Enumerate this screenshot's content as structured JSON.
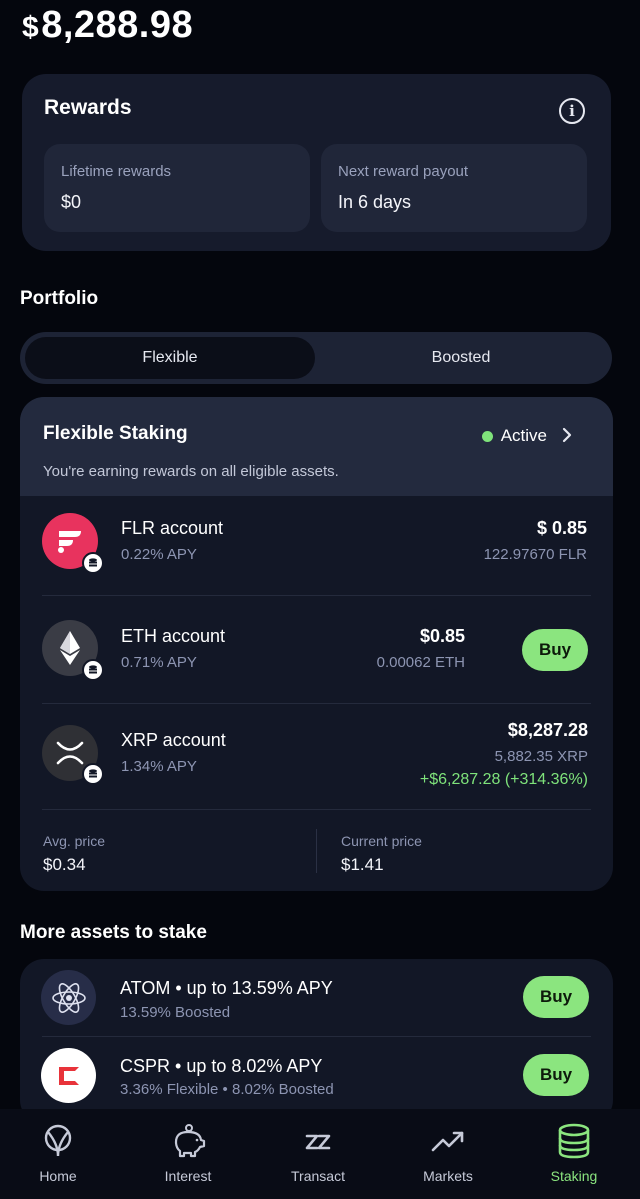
{
  "balance": {
    "currency": "$",
    "amount": "8,288.98"
  },
  "rewards": {
    "title": "Rewards",
    "lifetime_label": "Lifetime rewards",
    "lifetime_value": "$0",
    "next_label": "Next reward payout",
    "next_value": "In 6 days"
  },
  "portfolio": {
    "title": "Portfolio",
    "tabs": [
      {
        "label": "Flexible",
        "active": true
      },
      {
        "label": "Boosted",
        "active": false
      }
    ]
  },
  "flexible_staking": {
    "title": "Flexible Staking",
    "status": "Active",
    "subtitle": "You're earning rewards on all eligible assets.",
    "accounts": [
      {
        "name": "FLR account",
        "apy": "0.22% APY",
        "value": "$ 0.85",
        "quantity": "122.97670 FLR",
        "icon": "flare-icon",
        "color": "#e8335e"
      },
      {
        "name": "ETH account",
        "apy": "0.71% APY",
        "value": "$0.85",
        "quantity": "0.00062 ETH",
        "icon": "ethereum-icon",
        "buy": "Buy",
        "color": "#3a3c45"
      },
      {
        "name": "XRP account",
        "apy": "1.34% APY",
        "value": "$8,287.28",
        "quantity": "5,882.35 XRP",
        "gain": "+$6,287.28 (+314.36%)",
        "icon": "xrp-icon",
        "color": "#2f3035"
      }
    ],
    "avg_price_label": "Avg. price",
    "avg_price_value": "$0.34",
    "current_price_label": "Current price",
    "current_price_value": "$1.41"
  },
  "more_assets": {
    "title": "More assets to stake",
    "items": [
      {
        "name": "ATOM • up to 13.59% APY",
        "sub": "13.59% Boosted",
        "buy": "Buy",
        "icon": "cosmos-atom-icon"
      },
      {
        "name": "CSPR • up to 8.02% APY",
        "sub": "3.36% Flexible • 8.02% Boosted",
        "buy": "Buy",
        "icon": "casper-icon"
      }
    ]
  },
  "tabbar": [
    {
      "label": "Home",
      "icon": "home-icon"
    },
    {
      "label": "Interest",
      "icon": "piggy-bank-icon"
    },
    {
      "label": "Transact",
      "icon": "transact-icon"
    },
    {
      "label": "Markets",
      "icon": "trend-up-icon"
    },
    {
      "label": "Staking",
      "icon": "staking-coins-icon",
      "active": true
    }
  ],
  "colors": {
    "accent_green": "#8be57f",
    "background": "#04060d",
    "card": "#161b2c"
  }
}
